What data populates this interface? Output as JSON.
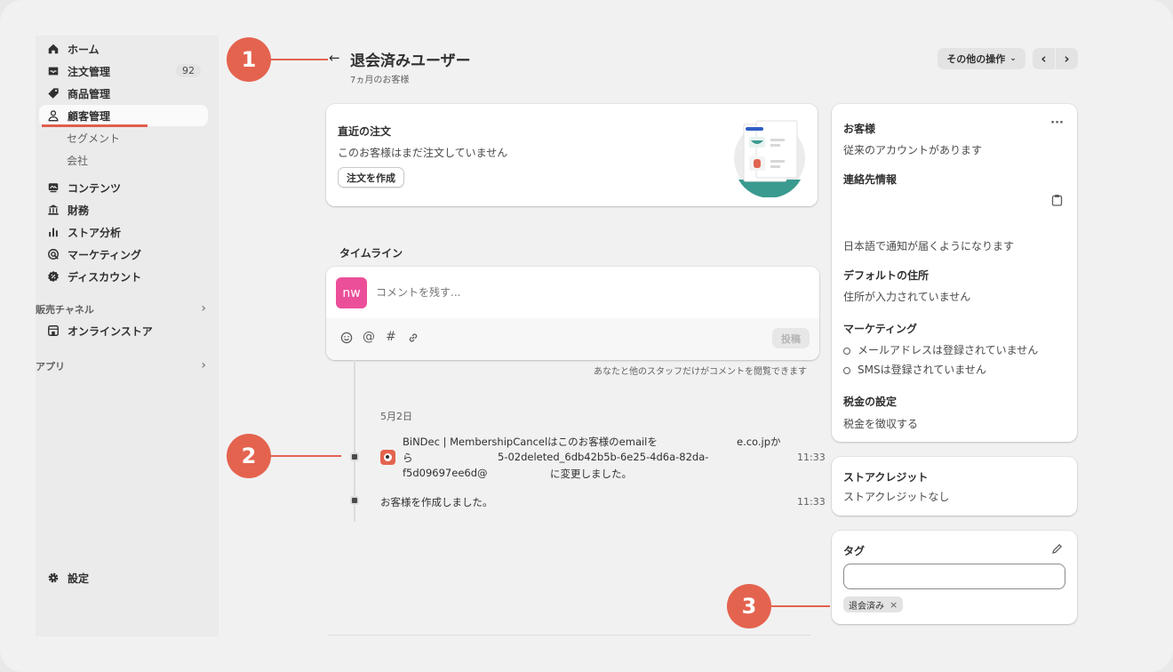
{
  "sidebar": {
    "items": [
      {
        "label": "ホーム",
        "icon": "home-icon"
      },
      {
        "label": "注文管理",
        "icon": "inbox-icon",
        "badge": "92"
      },
      {
        "label": "商品管理",
        "icon": "tag-icon"
      },
      {
        "label": "顧客管理",
        "icon": "person-icon",
        "active": true
      },
      {
        "label": "コンテンツ",
        "icon": "content-icon"
      },
      {
        "label": "財務",
        "icon": "bank-icon"
      },
      {
        "label": "ストア分析",
        "icon": "bar-chart-icon"
      },
      {
        "label": "マーケティング",
        "icon": "target-icon"
      },
      {
        "label": "ディスカウント",
        "icon": "discount-icon"
      }
    ],
    "sub_items": [
      "セグメント",
      "会社"
    ],
    "sales_channels_label": "販売チャネル",
    "online_store_label": "オンラインストア",
    "apps_label": "アプリ",
    "settings_label": "設定"
  },
  "header": {
    "back_arrow": "←",
    "title": "退会済みユーザー",
    "subtitle": "7ヵ月のお客様",
    "more_actions_label": "その他の操作",
    "prev_label": "‹",
    "next_label": "›"
  },
  "callouts": [
    "1",
    "2",
    "3"
  ],
  "recent_orders": {
    "title": "直近の注文",
    "empty_text": "このお客様はまだ注文していません",
    "create_order_label": "注文を作成"
  },
  "timeline": {
    "title": "タイムライン",
    "avatar_initials": "nw",
    "comment_placeholder": "コメントを残す...",
    "post_label": "投稿",
    "notice": "あなたと他のスタッフだけがコメントを閲覧できます",
    "date_label": "5月2日",
    "events": [
      {
        "line1a": "BiNDec | MembershipCancelはこのお客様のemailを",
        "line1b": "e.co.jpか",
        "line2a": "ら",
        "line2b": "5-02deleted_6db42b5b-6e25-4d6a-82da-",
        "line3a": "f5d09697ee6d@",
        "line3b": "に変更しました。",
        "time": "11:33"
      },
      {
        "text": "お客様を作成しました。",
        "time": "11:33"
      }
    ]
  },
  "customer": {
    "title": "お客様",
    "more_label": "···",
    "account_text": "従来のアカウントがあります",
    "contact_title": "連絡先情報",
    "notification_text": "日本語で通知が届くようになります",
    "address_title": "デフォルトの住所",
    "address_text": "住所が入力されていません",
    "marketing_title": "マーケティング",
    "marketing_email": "メールアドレスは登録されていません",
    "marketing_sms": "SMSは登録されていません",
    "tax_title": "税金の設定",
    "tax_text": "税金を徴収する"
  },
  "store_credit": {
    "title": "ストアクレジット",
    "text": "ストアクレジットなし"
  },
  "tags": {
    "title": "タグ",
    "input_value": "",
    "tag_label": "退会済み",
    "remove_label": "×"
  },
  "colors": {
    "callout": "#e4634f",
    "avatar": "#ec4f9a",
    "illustration_teal": "#3a9a8f"
  }
}
